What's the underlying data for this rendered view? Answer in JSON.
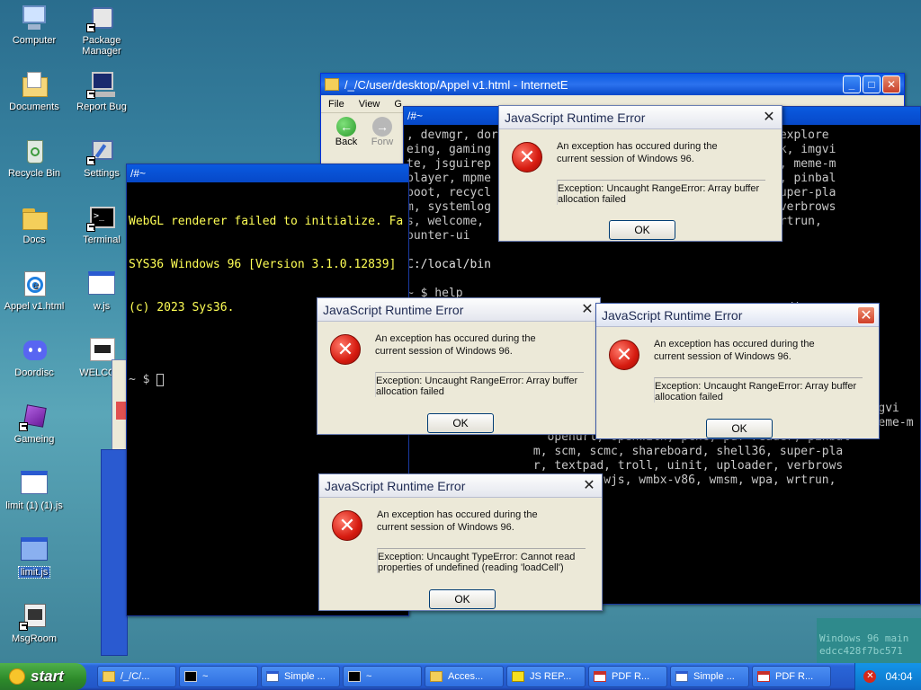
{
  "desktop_icons": [
    {
      "label": "Computer",
      "icon": "computer-icon"
    },
    {
      "label": "Package Manager",
      "icon": "package-icon"
    },
    {
      "label": "Documents",
      "icon": "documents-icon"
    },
    {
      "label": "Report Bug",
      "icon": "bug-report-icon"
    },
    {
      "label": "Recycle Bin",
      "icon": "recycle-bin-icon"
    },
    {
      "label": "Settings",
      "icon": "settings-icon"
    },
    {
      "label": "Docs",
      "icon": "folder-icon"
    },
    {
      "label": "Terminal",
      "icon": "terminal-icon"
    },
    {
      "label": "Appel v1.html",
      "icon": "html-file-icon"
    },
    {
      "label": "w.js",
      "icon": "js-file-icon"
    },
    {
      "label": "Doordisc",
      "icon": "discord-icon"
    },
    {
      "label": "WELCOM",
      "icon": "welcome-icon"
    },
    {
      "label": "Gameing",
      "icon": "game-icon"
    },
    {
      "label": "limit (1) (1).js",
      "icon": "js-file-icon"
    },
    {
      "label": "limit.js",
      "icon": "js-file-icon"
    },
    {
      "label": "MsgRoom",
      "icon": "msgroom-icon"
    }
  ],
  "browser": {
    "title": "/_/C/user/desktop/Appel v1.html - InternetE",
    "menu": [
      "File",
      "View",
      "G"
    ],
    "back_label": "Back",
    "forward_label": "Forw"
  },
  "terminal_left": {
    "title": "~",
    "lines": [
      "WebGL renderer failed to initialize. Fa",
      "SYS36 Windows 96 [Version 3.1.0.12839]",
      "(c) 2023 Sys36.",
      "",
      "~ $ "
    ]
  },
  "terminal_right": {
    "title": "~",
    "lines": [
      ", devmgr, dor                            s, effects, explore",
      "eing, gaming                             oworld, ifsck, imgvi",
      "te, jsguirep                             trix, mdview, meme-m",
      "player, mpme                             , pdf-reader, pinbal",
      "boot, recycl                             , shell36, super-pla",
      "m, systemlog                             , uploader, verbrows",
      "s, welcome,                              wmsm, wpa, wrtrun, ",
      "ounter-ui",
      "",
      "C:/local/bin",
      "",
      "~ $ help",
      "                                                      dir, m",
      "                                                    , icon",
      "",
      "",
      "",
      "                                                      st, cr",
      ", devmgr, donation-ui, dos                      , explore",
      "eing, gaming-runner, gaming-streamed, gltest, helloworld, ifsck, imgvi",
      "te, jsguirepl, jsh, linux, livecss, logon, lsvol, matrix, mdview, meme-m",
      "                    openurl, openwith, pchc, pdf-reader, pinbal",
      "                  m, scm, scmc, shareboard, shell36, super-pla",
      "                  r, textpad, troll, uinit, uploader, verbrows",
      "                   winmp96, wjs, wmbx-v86, wmsm, wpa, wrtrun, "
    ]
  },
  "watermark": [
    "Windows 96 main",
    "edcc428f7bc571"
  ],
  "dialogs": [
    {
      "title": "JavaScript Runtime Error",
      "message": "An exception has occured during the current session of Windows 96.",
      "exception": "Exception: Uncaught RangeError: Array buffer allocation failed",
      "ok": "OK"
    },
    {
      "title": "JavaScript Runtime Error",
      "message": "An exception has occured during the current session of Windows 96.",
      "exception": "Exception: Uncaught RangeError: Array buffer allocation failed",
      "ok": "OK"
    },
    {
      "title": "JavaScript Runtime Error",
      "message": "An exception has occured during the current session of Windows 96.",
      "exception": "Exception: Uncaught RangeError: Array buffer allocation failed",
      "ok": "OK"
    },
    {
      "title": "JavaScript Runtime Error",
      "message": "An exception has occured during the current session of Windows 96.",
      "exception": "Exception: Uncaught TypeError: Cannot read properties of undefined (reading 'loadCell')",
      "ok": "OK"
    }
  ],
  "taskbar": {
    "start_label": "start",
    "tasks": [
      "/_/C/...",
      "~",
      "Simple ...",
      "~",
      "Acces...",
      "JS REP...",
      "PDF R...",
      "Simple ...",
      "PDF R..."
    ],
    "clock": "04:04"
  }
}
